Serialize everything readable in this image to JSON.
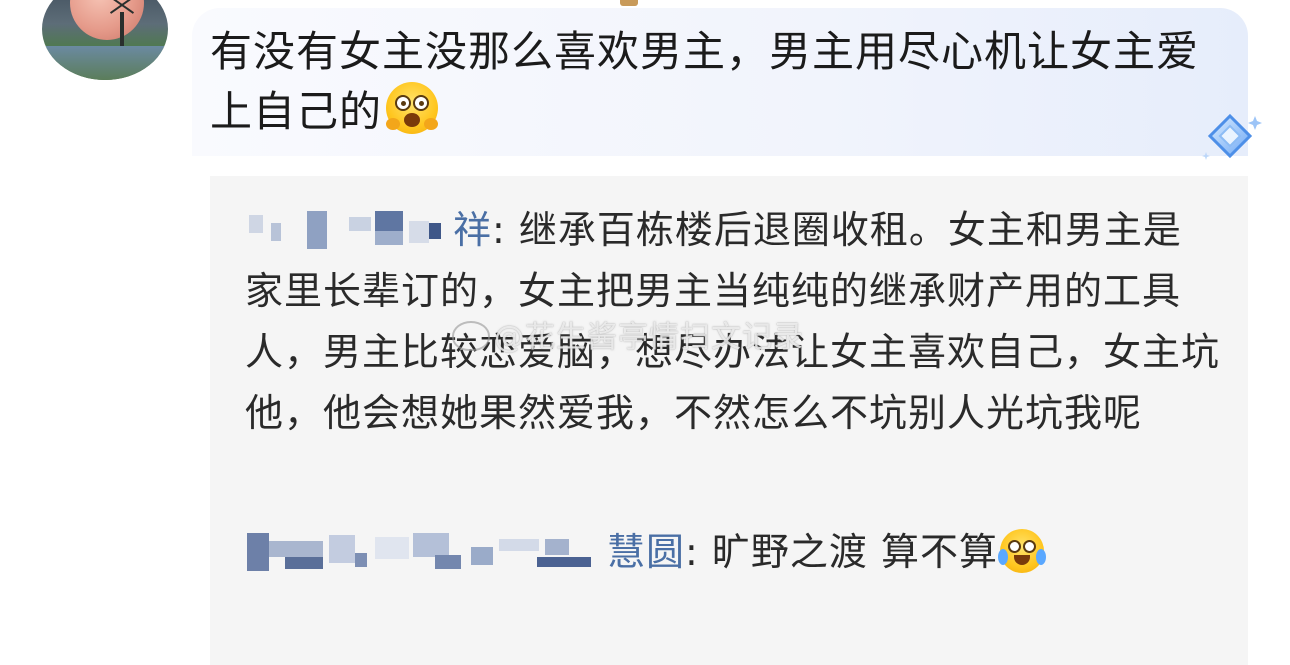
{
  "post": {
    "text": "有没有女主没那么喜欢男主，男主用尽心机让女主爱上自己的"
  },
  "comments": [
    {
      "username_visible": "祥",
      "separator": ": ",
      "text": "继承百栋楼后退圈收租。女主和男主是家里长辈订的，女主把男主当纯纯的继承财产用的工具人，男主比较恋爱脑，想尽办法让女主喜欢自己，女主坑他，他会想她果然爱我，不然怎么不坑别人光坑我呢"
    },
    {
      "username_visible": "慧圆",
      "separator": ": ",
      "text": "旷野之渡 算不算"
    }
  ],
  "watermark": {
    "text": "@花生酱亭情扫文记录"
  },
  "icons": {
    "post_emoji": "shocked-face-emoji",
    "comment_emoji": "crying-face-emoji",
    "badge": "diamond-badge-icon",
    "avatar": "moon-windmill-avatar"
  },
  "colors": {
    "username": "#4a6fa5",
    "comment_bg": "#f5f5f5",
    "text": "#1b1b1b"
  }
}
